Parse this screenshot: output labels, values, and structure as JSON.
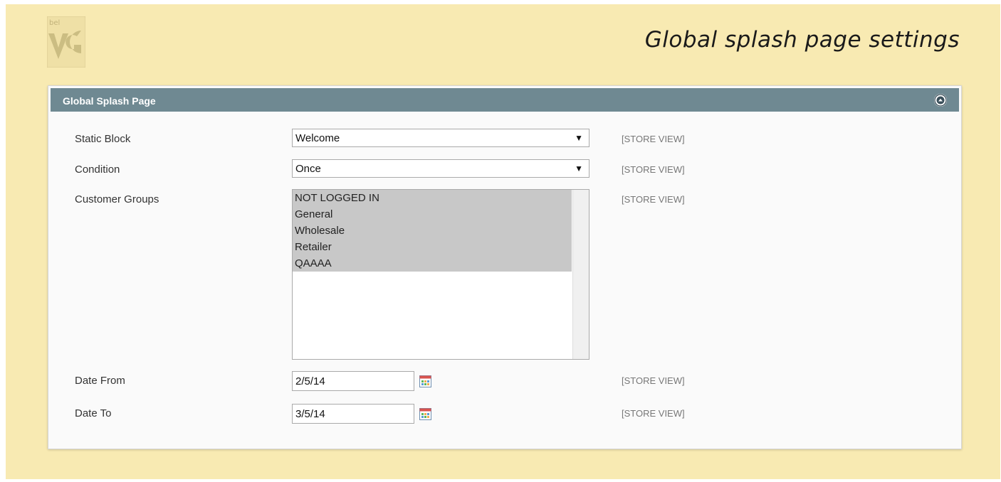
{
  "page": {
    "heading": "Global splash page settings"
  },
  "panel": {
    "title": "Global Splash Page",
    "fields": {
      "static_block": {
        "label": "Static Block",
        "value": "Welcome",
        "scope": "[STORE VIEW]"
      },
      "condition": {
        "label": "Condition",
        "value": "Once",
        "scope": "[STORE VIEW]"
      },
      "customer_groups": {
        "label": "Customer Groups",
        "options": [
          "NOT LOGGED IN",
          "General",
          "Wholesale",
          "Retailer",
          "QAAAA"
        ],
        "scope": "[STORE VIEW]"
      },
      "date_from": {
        "label": "Date From",
        "value": "2/5/14",
        "scope": "[STORE VIEW]"
      },
      "date_to": {
        "label": "Date To",
        "value": "3/5/14",
        "scope": "[STORE VIEW]"
      }
    }
  },
  "icons": {
    "logo": "bel-vg-logo",
    "collapse": "chevron-up-circle-icon",
    "calendar": "calendar-icon",
    "dropdown": "triangle-down-icon"
  },
  "colors": {
    "background": "#f8eab2",
    "panel_header": "#6f8992",
    "selected_option": "#c8c8c8"
  }
}
